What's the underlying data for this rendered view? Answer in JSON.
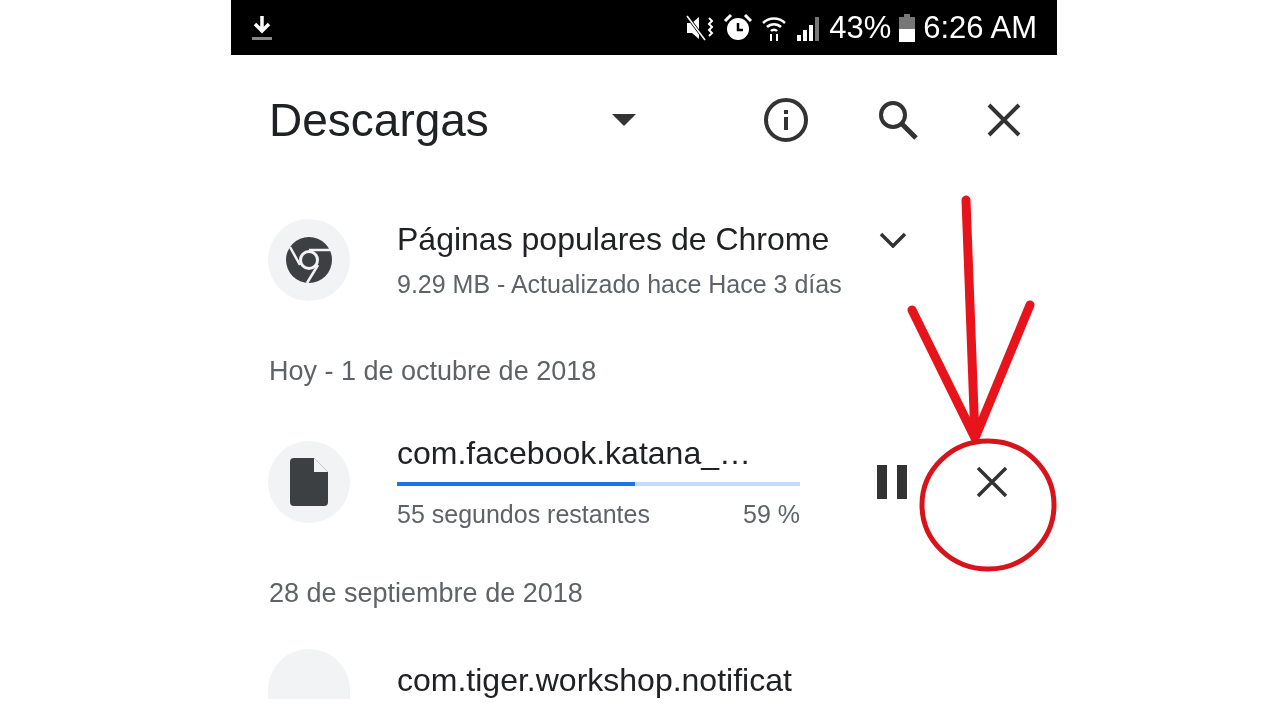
{
  "status_bar": {
    "battery": "43%",
    "time": "6:26 AM"
  },
  "header": {
    "title": "Descargas"
  },
  "featured": {
    "title": "Páginas populares de Chrome",
    "subtitle": "9.29 MB - Actualizado hace Hace 3 días",
    "expanded": false
  },
  "sections": [
    {
      "date": "Hoy - 1 de octubre de 2018",
      "items": [
        {
          "kind": "progress",
          "name": "com.facebook.katana_…",
          "level": 0.59,
          "remaining": "55 segundos restantes",
          "percent": "59 %"
        }
      ]
    },
    {
      "date": "28 de septiembre de 2018",
      "items": [
        {
          "kind": "file",
          "name": "com.tiger.workshop.notificat"
        }
      ]
    }
  ]
}
